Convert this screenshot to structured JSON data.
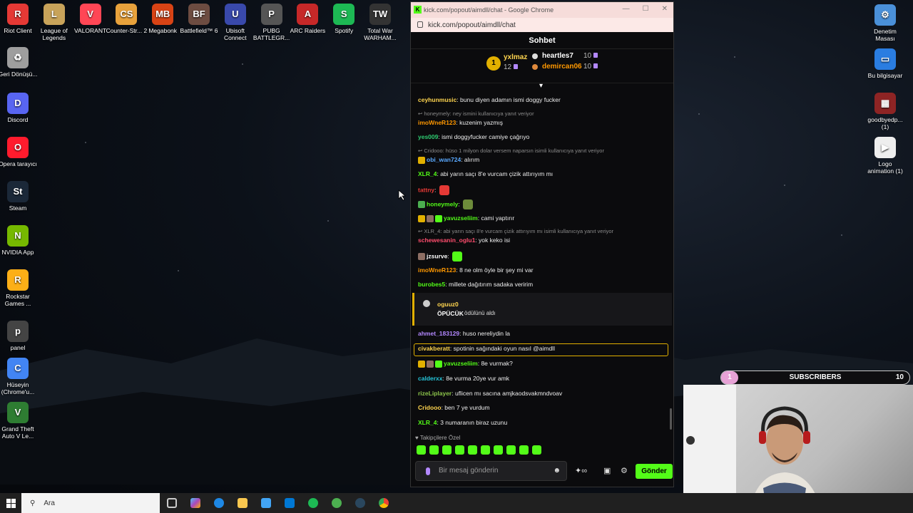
{
  "desktop": {
    "top_icons": [
      {
        "label": "Riot Client",
        "color": "#e53935",
        "glyph": "R"
      },
      {
        "label": "League of Legends",
        "color": "#c8a35a",
        "glyph": "L"
      },
      {
        "label": "VALORANT",
        "color": "#ff4655",
        "glyph": "V"
      },
      {
        "label": "Counter-Str... 2",
        "color": "#e8a23c",
        "glyph": "CS"
      },
      {
        "label": "Megabonk",
        "color": "#d84315",
        "glyph": "MB"
      },
      {
        "label": "Battlefield™ 6",
        "color": "#6d4c41",
        "glyph": "BF"
      },
      {
        "label": "Ubisoft Connect",
        "color": "#3949ab",
        "glyph": "U"
      },
      {
        "label": "PUBG BATTLEGR...",
        "color": "#555555",
        "glyph": "P"
      },
      {
        "label": "ARC Raiders",
        "color": "#c62828",
        "glyph": "A"
      },
      {
        "label": "Spotify",
        "color": "#1db954",
        "glyph": "S"
      },
      {
        "label": "Total War WARHAM...",
        "color": "#333333",
        "glyph": "TW"
      }
    ],
    "left_icons": [
      {
        "label": "Geri Dönüşü...",
        "color": "#9e9e9e",
        "glyph": "♻"
      },
      {
        "label": "Discord",
        "color": "#5865f2",
        "glyph": "D"
      },
      {
        "label": "Opera tarayıcı",
        "color": "#ff1b2d",
        "glyph": "O"
      },
      {
        "label": "Steam",
        "color": "#1b2838",
        "glyph": "St"
      },
      {
        "label": "NVIDIA App",
        "color": "#76b900",
        "glyph": "N"
      },
      {
        "label": "Rockstar Games ...",
        "color": "#fcaf17",
        "glyph": "R"
      },
      {
        "label": "panel",
        "color": "#444444",
        "glyph": "p"
      },
      {
        "label": "Hüseyin (Chrome'u...",
        "color": "#4285f4",
        "glyph": "C"
      },
      {
        "label": "Grand Theft Auto V Le...",
        "color": "#2e7d32",
        "glyph": "V"
      }
    ],
    "right_icons": [
      {
        "label": "Denetim Masası",
        "color": "#4a90d9",
        "glyph": "⚙"
      },
      {
        "label": "Bu bilgisayar",
        "color": "#2a7de1",
        "glyph": "▭"
      },
      {
        "label": "goodbyedp... (1)",
        "color": "#8e2424",
        "glyph": "▦"
      },
      {
        "label": "Logo animation (1)",
        "color": "#eeeeee",
        "glyph": "▶"
      }
    ]
  },
  "browser": {
    "title": "kick.com/popout/aimdll/chat - Google Chrome",
    "url": "kick.com/popout/aimdll/chat",
    "header": "Sohbet",
    "leaderboard": {
      "first": {
        "rank": "1",
        "name": "yxlmaz",
        "count": "12"
      },
      "others": [
        {
          "name": "heartles7",
          "count": "10"
        },
        {
          "name": "demircan06",
          "count": "10"
        }
      ]
    },
    "messages": [
      {
        "user": "ceyhunmusic",
        "color": "#ffd54f",
        "text": ": bunu diyen adamın ismi doggy fucker"
      },
      {
        "reply": "honeymely: ney ismini kullanıcıya yanıt veriyor"
      },
      {
        "user": "imoWneR123",
        "color": "#ff9800",
        "text": ": kuzenim yazmış"
      },
      {
        "user": "yes009",
        "color": "#2ecc71",
        "text": ": ismi doggyfucker camiye çağrıyo"
      },
      {
        "reply": "Cridooo: hüso 1 milyon dolar versem naparsın isimli kullanıcıya yanıt veriyor"
      },
      {
        "user": "obi_wan724",
        "color": "#5aa9ff",
        "text": ": alırım"
      },
      {
        "user": "XLR_4",
        "color": "#53fc18",
        "text": ": abi yarın saçı 8'e vurcam çizik attırıyım mı"
      },
      {
        "user": "tattny",
        "color": "#e53935",
        "text": ":"
      },
      {
        "user": "honeymely",
        "color": "#53fc18",
        "text": ":"
      },
      {
        "user": "yavuzseliim",
        "color": "#53fc18",
        "text": ": cami yaptırır"
      },
      {
        "reply": "XLR_4: abi yarın saçı 8'e vurcam çizik attırıyım mı isimli kullanıcıya yanıt veriyor"
      },
      {
        "user": "schewesanin_oglu1",
        "color": "#ff4d6d",
        "text": ": yok keko isi"
      },
      {
        "user": "jzsurve",
        "color": "#ffffff",
        "text": ":"
      },
      {
        "user": "imoWneR123",
        "color": "#ff9800",
        "text": ": 8 ne olm öyle bir şey mi var"
      },
      {
        "user": "burobes5",
        "color": "#53fc18",
        "text": ": millete dağıtırım sadaka veririm"
      },
      {
        "user": "ahmet_183129",
        "color": "#b388ff",
        "text": ": huso nereliydin la"
      },
      {
        "user": "civakberatt",
        "color": "#ffd54f",
        "text": ": spotinin sağındaki oyun nasıl @aimdll"
      },
      {
        "user": "yavuzseliim",
        "color": "#53fc18",
        "text": ": 8e vurmak?"
      },
      {
        "user": "calderxx",
        "color": "#26c6da",
        "text": ": 8e vurma 20ye vur amk"
      },
      {
        "user": "rizeLiplayer",
        "color": "#8bc34a",
        "text": ": uflicen mı sacına amjkaodsvakmndvoav"
      },
      {
        "user": "Cridooo",
        "color": "#ffd54f",
        "text": ": ben 7 ye vurdum"
      },
      {
        "user": "XLR_4",
        "color": "#53fc18",
        "text": ": 3 numaranın biraz uzunu"
      }
    ],
    "reward": {
      "user": "oguuz0",
      "item": "ÖPÜCÜK",
      "text": " ödülünü aldı"
    },
    "followers_label": "Takipçilere Özel",
    "input_placeholder": "Bir mesaj gönderin",
    "send_label": "Gönder"
  },
  "overlay": {
    "subscribers_label": "SUBSCRIBERS",
    "subscribers_count": "10",
    "progress_badge": "1"
  },
  "taskbar": {
    "search_placeholder": "Ara"
  }
}
